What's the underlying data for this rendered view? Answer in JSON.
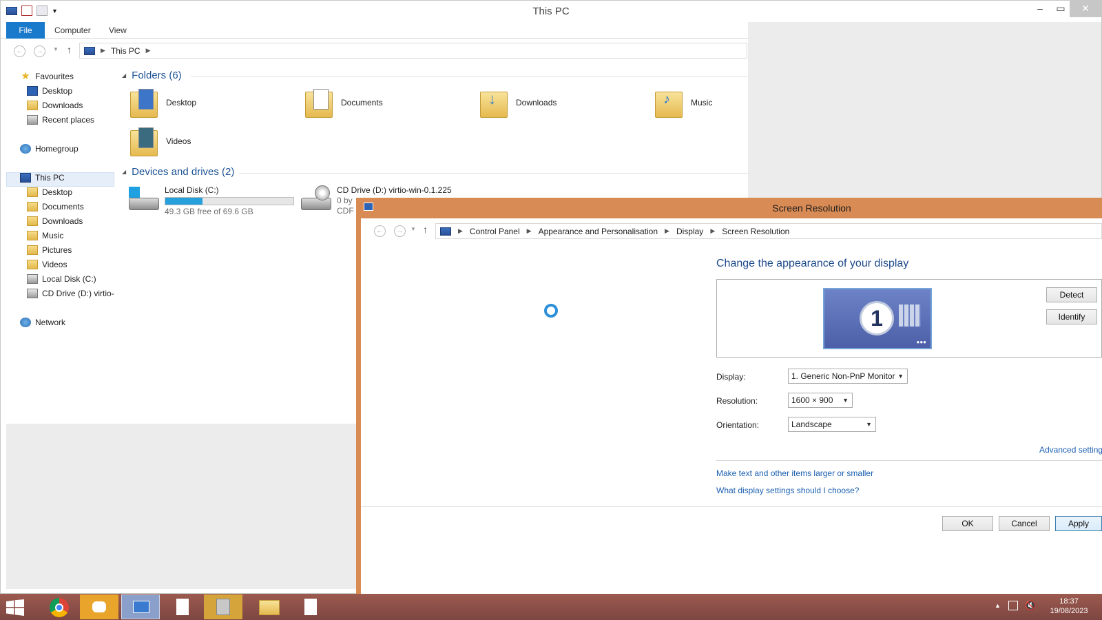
{
  "explorer": {
    "window_title": "This PC",
    "ribbon_tabs": [
      "File",
      "Computer",
      "View"
    ],
    "address": "This PC",
    "sidebar": {
      "favourites": "Favourites",
      "fav_items": [
        "Desktop",
        "Downloads",
        "Recent places"
      ],
      "homegroup": "Homegroup",
      "thispc": "This PC",
      "pc_items": [
        "Desktop",
        "Documents",
        "Downloads",
        "Music",
        "Pictures",
        "Videos",
        "Local Disk (C:)",
        "CD Drive (D:) virtio-w"
      ],
      "network": "Network"
    },
    "folders_header": "Folders (6)",
    "folders": [
      "Desktop",
      "Documents",
      "Downloads",
      "Music",
      "Videos"
    ],
    "drives_header": "Devices and drives (2)",
    "drives": [
      {
        "name": "Local Disk (C:)",
        "free": "49.3 GB free of 69.6 GB",
        "used_fraction": 0.29
      },
      {
        "name": "CD Drive (D:) virtio-win-0.1.225",
        "line2": "0 by",
        "line3": "CDF"
      }
    ]
  },
  "screen_resolution": {
    "title": "Screen Resolution",
    "breadcrumb": [
      "Control Panel",
      "Appearance and Personalisation",
      "Display",
      "Screen Resolution"
    ],
    "heading": "Change the appearance of your display",
    "monitor_number": "1",
    "detect_label": "Detect",
    "identify_label": "Identify",
    "display_label": "Display:",
    "display_value": "1. Generic Non-PnP Monitor",
    "resolution_label": "Resolution:",
    "resolution_value": "1600 × 900",
    "orientation_label": "Orientation:",
    "orientation_value": "Landscape",
    "advanced_link": "Advanced setting",
    "link_text_size": "Make text and other items larger or smaller",
    "link_choose": "What display settings should I choose?",
    "ok_label": "OK",
    "cancel_label": "Cancel",
    "apply_label": "Apply"
  },
  "taskbar": {
    "time": "18:37",
    "date": "19/08/2023"
  }
}
